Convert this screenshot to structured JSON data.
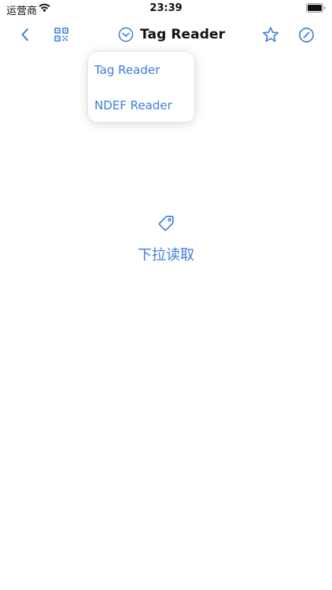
{
  "status_bar": {
    "carrier": "运营商",
    "time": "23:39",
    "icons": [
      "wifi-icon",
      "battery-icon"
    ]
  },
  "nav": {
    "title": "Tag Reader",
    "icons": {
      "back": "chevron-left-icon",
      "qr": "qr-code-icon",
      "title_chevron": "chevron-down-circle-icon",
      "favorite": "star-icon",
      "compass": "compass-icon"
    }
  },
  "dropdown": {
    "items": [
      {
        "label": "Tag Reader"
      },
      {
        "label": "NDEF Reader"
      }
    ]
  },
  "main": {
    "icon": "tag-icon",
    "prompt": "下拉读取"
  },
  "colors": {
    "accent": "#3e7ed6",
    "text": "#111111",
    "background": "#ffffff"
  }
}
